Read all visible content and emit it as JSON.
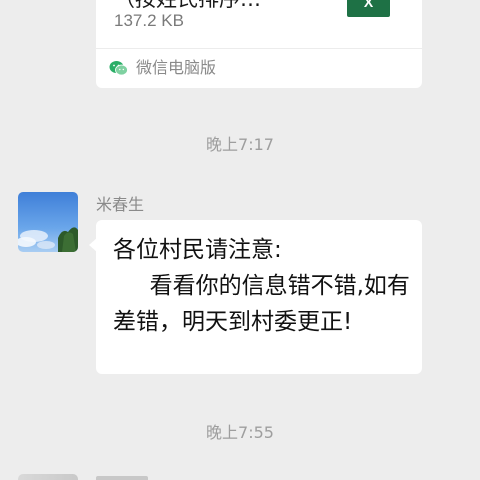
{
  "file_message": {
    "file_name": "（按姓氏排序…",
    "file_size": "137.2 KB",
    "file_icon_letter": "X",
    "source_label": "微信电脑版",
    "icon_color": "#1e7145"
  },
  "timestamps": {
    "first": "晚上7:17",
    "second": "晚上7:55"
  },
  "message": {
    "sender": "米春生",
    "text": "各位村民请注意:\n     看看你的信息错不错,如有差错，明天到村委更正!"
  },
  "colors": {
    "background": "#ededed",
    "bubble": "#ffffff",
    "excel_green": "#1e7145",
    "wechat_green": "#2aae67"
  }
}
